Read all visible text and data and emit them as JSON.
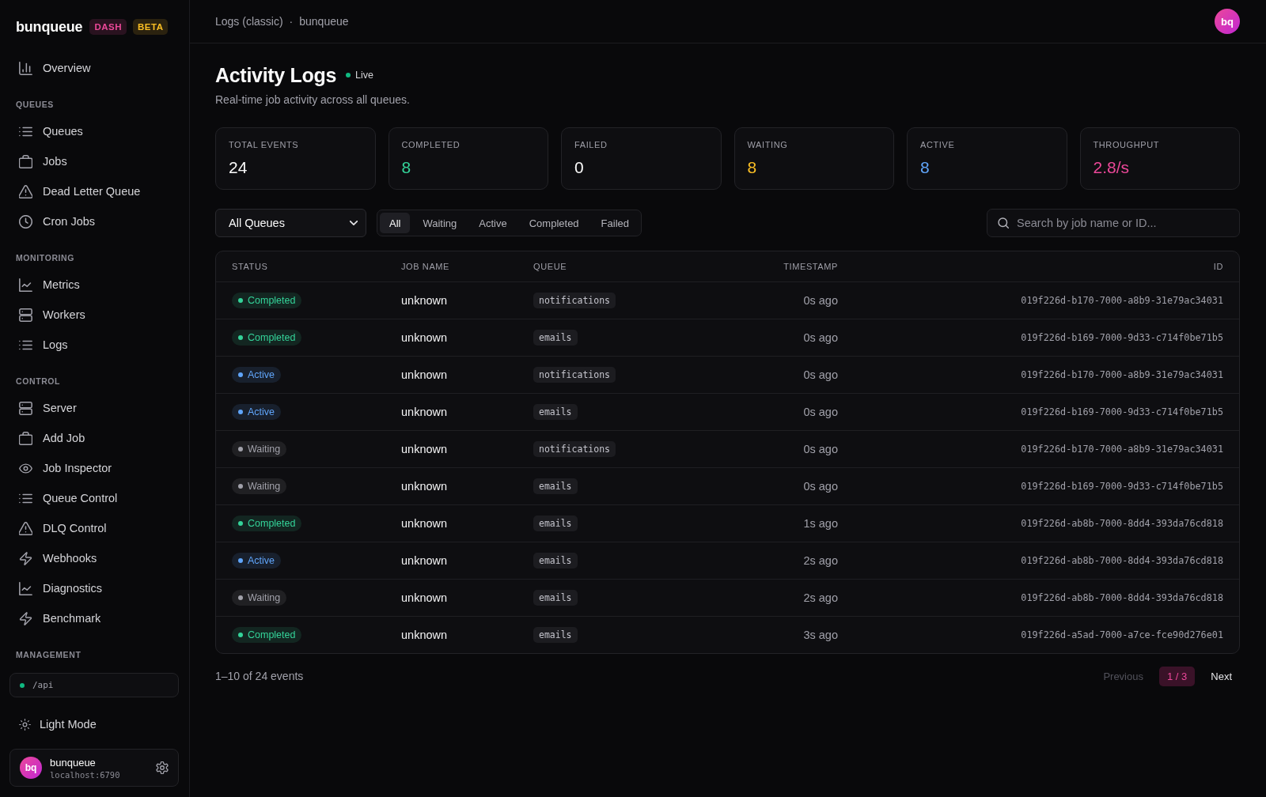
{
  "sidebar": {
    "brand": {
      "name": "bunqueue",
      "tags": [
        {
          "label": "DASH",
          "color": "#ec4899"
        },
        {
          "label": "BETA",
          "color": "#fbbf24"
        }
      ]
    },
    "sections": [
      {
        "items": [
          {
            "label": "Overview",
            "selected": false
          }
        ]
      },
      {
        "title": "QUEUES",
        "items": [
          {
            "label": "Queues",
            "selected": false
          },
          {
            "label": "Jobs",
            "selected": false
          },
          {
            "label": "Dead Letter Queue",
            "selected": false
          },
          {
            "label": "Cron Jobs",
            "selected": false
          }
        ]
      },
      {
        "title": "MONITORING",
        "items": [
          {
            "label": "Metrics",
            "selected": false
          },
          {
            "label": "Workers",
            "selected": false
          },
          {
            "label": "Logs",
            "selected": false
          }
        ]
      },
      {
        "title": "CONTROL",
        "items": [
          {
            "label": "Server",
            "selected": false
          },
          {
            "label": "Add Job",
            "selected": false
          },
          {
            "label": "Job Inspector",
            "selected": false
          },
          {
            "label": "Queue Control",
            "selected": false
          },
          {
            "label": "DLQ Control",
            "selected": false
          },
          {
            "label": "Webhooks",
            "selected": false
          },
          {
            "label": "Diagnostics",
            "selected": false
          },
          {
            "label": "Benchmark",
            "selected": false
          }
        ]
      }
    ],
    "management": {
      "title": "MANAGEMENT",
      "api_endpoint": "/api",
      "theme_toggle": "Light Mode",
      "user": {
        "initials": "bq",
        "name": "bunqueue",
        "host": "localhost:6790"
      }
    }
  },
  "header": {
    "breadcrumb": [
      "Logs (classic)",
      "bunqueue"
    ],
    "separator": "·",
    "avatar": "bq"
  },
  "page": {
    "title": "Activity Logs",
    "live": "Live",
    "subtitle": "Real-time job activity across all queues."
  },
  "stats": [
    {
      "label": "TOTAL EVENTS",
      "value": "24",
      "color": "#fafafa"
    },
    {
      "label": "COMPLETED",
      "value": "8",
      "color": "#34d399"
    },
    {
      "label": "FAILED",
      "value": "0",
      "color": "#fafafa"
    },
    {
      "label": "WAITING",
      "value": "8",
      "color": "#fbbf24"
    },
    {
      "label": "ACTIVE",
      "value": "8",
      "color": "#60a5fa"
    },
    {
      "label": "THROUGHPUT",
      "value": "2.8/s",
      "color": "#ec4899"
    }
  ],
  "filters": {
    "queue_select": "All Queues",
    "tabs": [
      {
        "label": "All",
        "selected": true
      },
      {
        "label": "Waiting",
        "selected": false
      },
      {
        "label": "Active",
        "selected": false
      },
      {
        "label": "Completed",
        "selected": false
      },
      {
        "label": "Failed",
        "selected": false
      }
    ],
    "search": {
      "placeholder": "Search by job name or ID..."
    }
  },
  "table": {
    "columns": [
      "STATUS",
      "JOB NAME",
      "QUEUE",
      "TIMESTAMP",
      "ID"
    ],
    "rows": [
      {
        "status": "Completed",
        "color": "#34d399",
        "job_name": "unknown",
        "queue": "notifications",
        "timestamp": "0s ago",
        "id": "019f226d-b170-7000-a8b9-31e79ac34031"
      },
      {
        "status": "Completed",
        "color": "#34d399",
        "job_name": "unknown",
        "queue": "emails",
        "timestamp": "0s ago",
        "id": "019f226d-b169-7000-9d33-c714f0be71b5"
      },
      {
        "status": "Active",
        "color": "#60a5fa",
        "job_name": "unknown",
        "queue": "notifications",
        "timestamp": "0s ago",
        "id": "019f226d-b170-7000-a8b9-31e79ac34031"
      },
      {
        "status": "Active",
        "color": "#60a5fa",
        "job_name": "unknown",
        "queue": "emails",
        "timestamp": "0s ago",
        "id": "019f226d-b169-7000-9d33-c714f0be71b5"
      },
      {
        "status": "Waiting",
        "color": "#a1a1aa",
        "job_name": "unknown",
        "queue": "notifications",
        "timestamp": "0s ago",
        "id": "019f226d-b170-7000-a8b9-31e79ac34031"
      },
      {
        "status": "Waiting",
        "color": "#a1a1aa",
        "job_name": "unknown",
        "queue": "emails",
        "timestamp": "0s ago",
        "id": "019f226d-b169-7000-9d33-c714f0be71b5"
      },
      {
        "status": "Completed",
        "color": "#34d399",
        "job_name": "unknown",
        "queue": "emails",
        "timestamp": "1s ago",
        "id": "019f226d-ab8b-7000-8dd4-393da76cd818"
      },
      {
        "status": "Active",
        "color": "#60a5fa",
        "job_name": "unknown",
        "queue": "emails",
        "timestamp": "2s ago",
        "id": "019f226d-ab8b-7000-8dd4-393da76cd818"
      },
      {
        "status": "Waiting",
        "color": "#a1a1aa",
        "job_name": "unknown",
        "queue": "emails",
        "timestamp": "2s ago",
        "id": "019f226d-ab8b-7000-8dd4-393da76cd818"
      },
      {
        "status": "Completed",
        "color": "#34d399",
        "job_name": "unknown",
        "queue": "emails",
        "timestamp": "3s ago",
        "id": "019f226d-a5ad-7000-a7ce-fce90d276e01"
      }
    ]
  },
  "pagination": {
    "summary": "1–10 of 24 events",
    "previous": {
      "label": "Previous",
      "disabled": true
    },
    "page": "1 / 3",
    "next": {
      "label": "Next",
      "disabled": false
    }
  }
}
